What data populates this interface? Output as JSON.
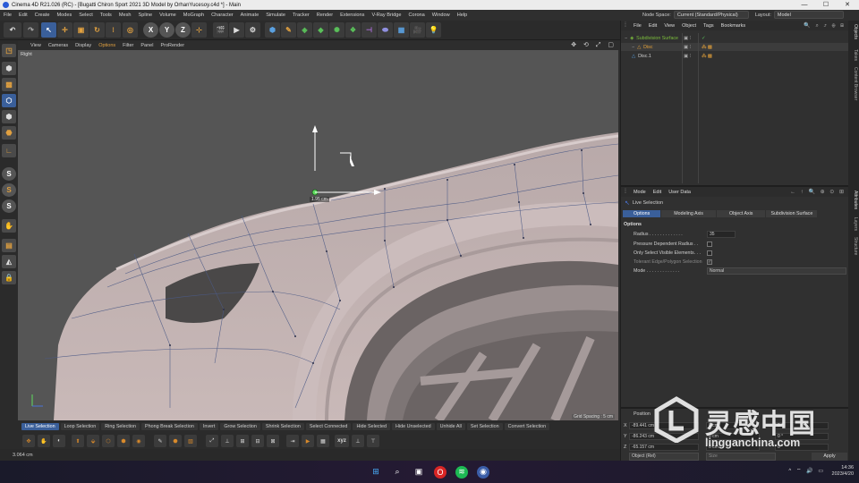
{
  "window": {
    "title": "Cinema 4D R21.026 (RC) - [Bugatti Chiron Sport 2021 3D Model by OrhanYucesoy.c4d *] - Main"
  },
  "menu": [
    "File",
    "Edit",
    "Create",
    "Modes",
    "Select",
    "Tools",
    "Mesh",
    "Spline",
    "Volume",
    "MoGraph",
    "Character",
    "Animate",
    "Simulate",
    "Tracker",
    "Render",
    "Extensions",
    "V-Ray Bridge",
    "Corona",
    "Window",
    "Help"
  ],
  "layout_bar": {
    "node_space_label": "Node Space:",
    "node_space_value": "Current (Standard/Physical)",
    "layout_label": "Layout:",
    "layout_value": "Model"
  },
  "toolbar": {
    "xyz": [
      "X",
      "Y",
      "Z"
    ]
  },
  "viewport": {
    "menu": [
      "View",
      "Cameras",
      "Display",
      "Options",
      "Filter",
      "Panel",
      "ProRender"
    ],
    "label": "Right",
    "dimension": "1.95 cm",
    "grid_spacing": "Grid Spacing : 5 cm"
  },
  "selection_tabs": [
    "Live Selection",
    "Loop Selection",
    "Ring Selection",
    "Phong Break Selection",
    "Invert",
    "Grow Selection",
    "Shrink Selection",
    "Select Connected",
    "Hide Selected",
    "Hide Unselected",
    "Unhide All",
    "Set Selection",
    "Convert Selection"
  ],
  "bottom_tools": {
    "xyz": "xyz"
  },
  "status": {
    "text": "3.064 cm"
  },
  "objects": {
    "menu": [
      "File",
      "Edit",
      "View",
      "Object",
      "Tags",
      "Bookmarks"
    ],
    "items": [
      {
        "name": "Subdivision Surface",
        "color": "#7cbf3c"
      },
      {
        "name": "Disc",
        "color": "#e7a33a"
      },
      {
        "name": "Disc.1",
        "color": "#cfcfcf"
      }
    ]
  },
  "side_tabs": {
    "top": [
      "Objects",
      "Takes",
      "Content Browser"
    ],
    "bottom": [
      "Attributes",
      "Layers",
      "Structure"
    ]
  },
  "attributes": {
    "menu": [
      "Mode",
      "Edit",
      "User Data"
    ],
    "title": "Live Selection",
    "tabs": [
      "Options",
      "Modeling Axis",
      "Object Axis",
      "Subdivision Surface"
    ],
    "section": "Options",
    "radius_label": "Radius . . . . . . . . . . . . .",
    "radius_value": "35",
    "pressure_label": "Pressure Dependent Radius . .",
    "visible_label": "Only Select Visible Elements. . .",
    "tolerant_label": "Tolerant Edge/Polygon Selection",
    "mode_label": "Mode . . . . . . . . . . . . .",
    "mode_value": "Normal"
  },
  "coordinates": {
    "header": "Position",
    "x": "-89.441 cm",
    "y": "-86.243 cm",
    "z": "-65.157 cm",
    "sx": "0 cm",
    "sy": "0 cm",
    "sz": "0 cm",
    "rh": "0 °",
    "rp": "0 °",
    "rb": "0 °",
    "object_dropdown": "Object (Rel)",
    "size_dropdown": "Size",
    "apply": "Apply"
  },
  "watermark": {
    "chinese": "灵感中国",
    "url": "lingganchina.com"
  },
  "tray": {
    "time": "14:36",
    "date": "2023/4/20"
  }
}
